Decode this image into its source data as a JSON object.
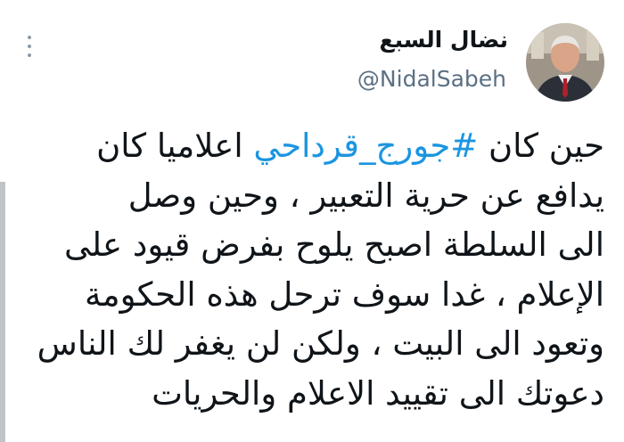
{
  "tweet": {
    "author": {
      "display_name": "نضال السبع",
      "handle": "@NidalSabeh",
      "avatar_icon": "person-photo"
    },
    "more_icon": "vertical-ellipsis-icon",
    "lines": [
      {
        "before": "حين كان ",
        "hashtag": "#جورج_قرداحي",
        "after": " اعلاميا كان"
      },
      {
        "text": "يدافع عن حرية التعبير ، وحين وصل"
      },
      {
        "text": "الى السلطة اصبح يلوح بفرض قيود على"
      },
      {
        "text": "الإعلام ، غدا سوف ترحل هذه الحكومة"
      },
      {
        "text": "وتعود الى البيت ، ولكن لن يغفر  لك الناس"
      },
      {
        "text": "دعوتك الى تقييد الاعلام والحريات"
      }
    ],
    "colors": {
      "text": "#0f1419",
      "secondary": "#5b7083",
      "hashtag": "#1b95e0"
    }
  }
}
